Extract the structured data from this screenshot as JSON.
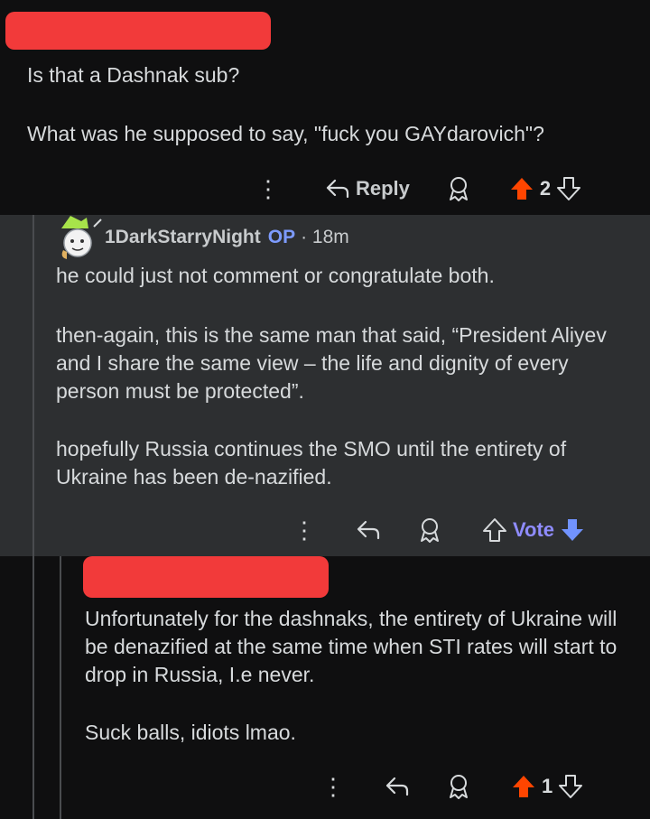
{
  "comment1": {
    "lines": [
      "Is that a Dashnak sub?",
      "What was he supposed to say, \"fuck you GAYdarovich\"?"
    ],
    "actions": {
      "reply_label": "Reply",
      "score": "2"
    }
  },
  "comment2": {
    "username": "1DarkStarryNight",
    "op_badge": "OP",
    "time": "· 18m",
    "paragraphs": [
      "he could just not comment or congratulate both.",
      "then-again, this is the same man that said, “President Aliyev and I share the same view – the life and dignity of every person must be protected”.",
      "hopefully Russia continues the SMO until the entirety of Ukraine has been de-nazified."
    ],
    "actions": {
      "vote_label": "Vote"
    }
  },
  "comment3": {
    "paragraphs": [
      "Unfortunately for the dashnaks, the entirety of Ukraine will be denazified at the same time when STI rates will start to drop in Russia, I.e never.",
      "Suck balls, idiots lmao."
    ],
    "actions": {
      "score": "1"
    }
  },
  "colors": {
    "upvote_active": "#ff4500",
    "downvote_active": "#7193ff",
    "redaction": "#f23a3a"
  },
  "icons": [
    "more-icon",
    "reply-icon",
    "award-icon",
    "upvote-icon",
    "downvote-icon"
  ]
}
